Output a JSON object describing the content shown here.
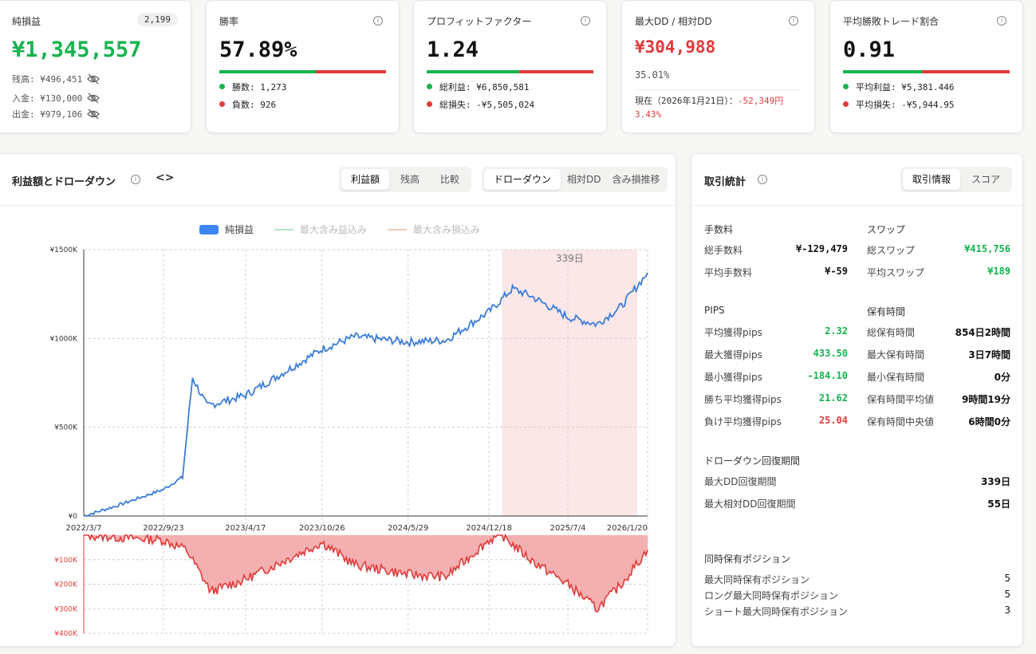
{
  "kpis": {
    "net_pl": {
      "label": "純損益",
      "badge": "2,199",
      "value": "¥1,345,557",
      "balance": "残高: ¥496,451",
      "deposit": "入金: ¥130,000",
      "withdrawal": "出金: ¥979,106"
    },
    "win_rate": {
      "label": "勝率",
      "value": "57.89%",
      "wins": "勝数: 1,273",
      "losses": "負数: 926",
      "ratio": 0.5789
    },
    "profit_factor": {
      "label": "プロフィットファクター",
      "value": "1.24",
      "gross_profit": "総利益: ¥6,850,581",
      "gross_loss": "総損失: -¥5,505,024",
      "ratio": 0.554
    },
    "max_dd": {
      "label": "最大DD / 相対DD",
      "value": "¥304,988",
      "relative": "35.01%",
      "current": "現在（2026年1月21日）：",
      "current_value": "-52,349円",
      "current_pct": "3.43%"
    },
    "avg_ratio": {
      "label": "平均勝敗トレード割合",
      "value": "0.91",
      "avg_profit": "平均利益: ¥5,381.446",
      "avg_loss": "平均損失: -¥5,944.95",
      "ratio": 0.475
    }
  },
  "chart_panel": {
    "title": "利益額とドローダウン",
    "tabs_left": [
      "利益額",
      "残高",
      "比較"
    ],
    "tabs_right": [
      "ドローダウン",
      "相対DD",
      "含み損推移"
    ],
    "legend": [
      "純損益",
      "最大含み益込み",
      "最大含み損込み"
    ]
  },
  "stats_panel": {
    "title": "取引統計",
    "tabs": [
      "取引情報",
      "スコア"
    ],
    "fees": {
      "title": "手数料",
      "rows": [
        {
          "k": "総手数料",
          "v": "¥-129,479"
        },
        {
          "k": "平均手数料",
          "v": "¥-59"
        }
      ]
    },
    "swap": {
      "title": "スワップ",
      "rows": [
        {
          "k": "総スワップ",
          "v": "¥415,756"
        },
        {
          "k": "平均スワップ",
          "v": "¥189"
        }
      ]
    },
    "pips": {
      "title": "PIPS",
      "rows": [
        {
          "k": "平均獲得pips",
          "v": "2.32"
        },
        {
          "k": "最大獲得pips",
          "v": "433.50"
        },
        {
          "k": "最小獲得pips",
          "v": "-184.10"
        },
        {
          "k": "勝ち平均獲得pips",
          "v": "21.62"
        },
        {
          "k": "負け平均獲得pips",
          "v": "25.04"
        }
      ]
    },
    "holding": {
      "title": "保有時間",
      "rows": [
        {
          "k": "総保有時間",
          "v": "854日2時間"
        },
        {
          "k": "最大保有時間",
          "v": "3日7時間"
        },
        {
          "k": "最小保有時間",
          "v": "0分"
        },
        {
          "k": "保有時間平均値",
          "v": "9時間19分"
        },
        {
          "k": "保有時間中央値",
          "v": "6時間0分"
        }
      ]
    },
    "recovery": {
      "title": "ドローダウン回復期間",
      "rows": [
        {
          "k": "最大DD回復期間",
          "v": "339日"
        },
        {
          "k": "最大相対DD回復期間",
          "v": "55日"
        }
      ]
    },
    "positions": {
      "title": "同時保有ポジション",
      "rows": [
        {
          "k": "最大同時保有ポジション",
          "v": "5"
        },
        {
          "k": "ロング最大同時保有ポジション",
          "v": "5"
        },
        {
          "k": "ショート最大同時保有ポジション",
          "v": "3"
        }
      ]
    }
  },
  "colors": {
    "green": "#16b34f",
    "red": "#e03a3a",
    "line": "#3b7dd8",
    "dd_fill": "#f4b0b0",
    "highlight": "#fbe7e7"
  },
  "chart_data": [
    {
      "type": "line",
      "series": [
        {
          "name": "純損益",
          "x": [
            "2022/3/7",
            "2022/6/1",
            "2022/9/23",
            "2022/11/10",
            "2022/12/5",
            "2023/1/10",
            "2023/4/17",
            "2023/7/1",
            "2023/10/26",
            "2024/1/15",
            "2024/5/29",
            "2024/9/1",
            "2024/12/18",
            "2025/2/15",
            "2025/4/1",
            "2025/7/4",
            "2025/9/15",
            "2025/11/15",
            "2026/1/20"
          ],
          "values": [
            0,
            60000,
            150000,
            220000,
            780000,
            620000,
            680000,
            780000,
            940000,
            1010000,
            980000,
            990000,
            1150000,
            1280000,
            1240000,
            1120000,
            1080000,
            1180000,
            1370000
          ]
        }
      ],
      "x_ticks": [
        "2022/3/7",
        "2022/9/23",
        "2023/4/17",
        "2023/10/26",
        "2024/5/29",
        "2024/12/18",
        "2025/7/4",
        "2026/1/20"
      ],
      "y_ticks": [
        "¥0",
        "¥500K",
        "¥1000K",
        "¥1500K"
      ],
      "ylim": [
        0,
        1500000
      ],
      "highlight": {
        "label": "339日",
        "from": "2025/1/20",
        "to": "2025/12/25"
      },
      "grid": true
    },
    {
      "type": "area",
      "series": [
        {
          "name": "ドローダウン",
          "x": [
            "2022/3/7",
            "2022/9/23",
            "2022/11/20",
            "2023/1/20",
            "2023/4/17",
            "2023/10/26",
            "2024/1/15",
            "2024/5/29",
            "2024/9/1",
            "2024/12/18",
            "2025/1/20",
            "2025/4/1",
            "2025/7/4",
            "2025/9/15",
            "2025/11/15",
            "2026/1/20"
          ],
          "values": [
            0,
            -20000,
            -60000,
            -230000,
            -180000,
            -30000,
            -120000,
            -160000,
            -170000,
            -20000,
            0,
            -100000,
            -200000,
            -300000,
            -200000,
            -60000
          ]
        }
      ],
      "y_ticks": [
        "¥100K",
        "¥200K",
        "¥300K",
        "¥400K"
      ],
      "ylim": [
        -400000,
        0
      ],
      "grid": true
    }
  ]
}
